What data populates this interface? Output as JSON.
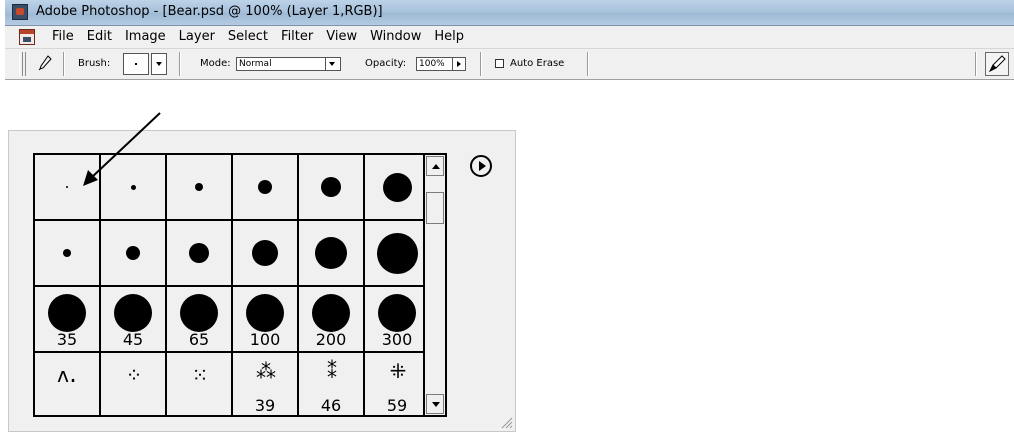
{
  "window": {
    "title": "Adobe Photoshop - [Bear.psd @ 100% (Layer 1,RGB)]",
    "app_icon": "photoshop-eye-icon"
  },
  "menubar": {
    "doc_icon": "document-icon",
    "items": [
      "File",
      "Edit",
      "Image",
      "Layer",
      "Select",
      "Filter",
      "View",
      "Window",
      "Help"
    ]
  },
  "options": {
    "tool_icon": "pencil-icon",
    "brush_label": "Brush:",
    "mode_label": "Mode:",
    "mode_value": "Normal",
    "opacity_label": "Opacity:",
    "opacity_value": "100%",
    "auto_erase_label": "Auto Erase",
    "auto_erase_checked": false,
    "brushes_tab_icon": "brush-tab-icon"
  },
  "brush_palette": {
    "rows": [
      [
        {
          "diameter": 1,
          "label": ""
        },
        {
          "diameter": 3,
          "label": ""
        },
        {
          "diameter": 5,
          "label": ""
        },
        {
          "diameter": 9,
          "label": ""
        },
        {
          "diameter": 13,
          "label": ""
        },
        {
          "diameter": 19,
          "label": ""
        }
      ],
      [
        {
          "diameter": 5,
          "label": ""
        },
        {
          "diameter": 9,
          "label": ""
        },
        {
          "diameter": 13,
          "label": ""
        },
        {
          "diameter": 17,
          "label": ""
        },
        {
          "diameter": 21,
          "label": ""
        },
        {
          "diameter": 27,
          "label": ""
        }
      ],
      [
        {
          "diameter": 35,
          "label": "35"
        },
        {
          "diameter": 45,
          "label": "45"
        },
        {
          "diameter": 65,
          "label": "65"
        },
        {
          "diameter": 100,
          "label": "100"
        },
        {
          "diameter": 200,
          "label": "200"
        },
        {
          "diameter": 300,
          "label": "300"
        }
      ],
      [
        {
          "kind": "spray",
          "glyph": "ʌ.",
          "label": ""
        },
        {
          "kind": "spray",
          "glyph": "⁘",
          "label": ""
        },
        {
          "kind": "spray",
          "glyph": "⁙",
          "label": ""
        },
        {
          "kind": "spray",
          "glyph": "⁂",
          "label": "39"
        },
        {
          "kind": "spray",
          "glyph": "⁑",
          "label": "46"
        },
        {
          "kind": "spray",
          "glyph": "⁜",
          "label": "59"
        }
      ]
    ],
    "menu_icon": "palette-menu-arrow-icon",
    "scroll_up_icon": "scroll-up-icon",
    "scroll_down_icon": "scroll-down-icon"
  },
  "annotation": {
    "arrow_icon": "callout-arrow-icon"
  }
}
